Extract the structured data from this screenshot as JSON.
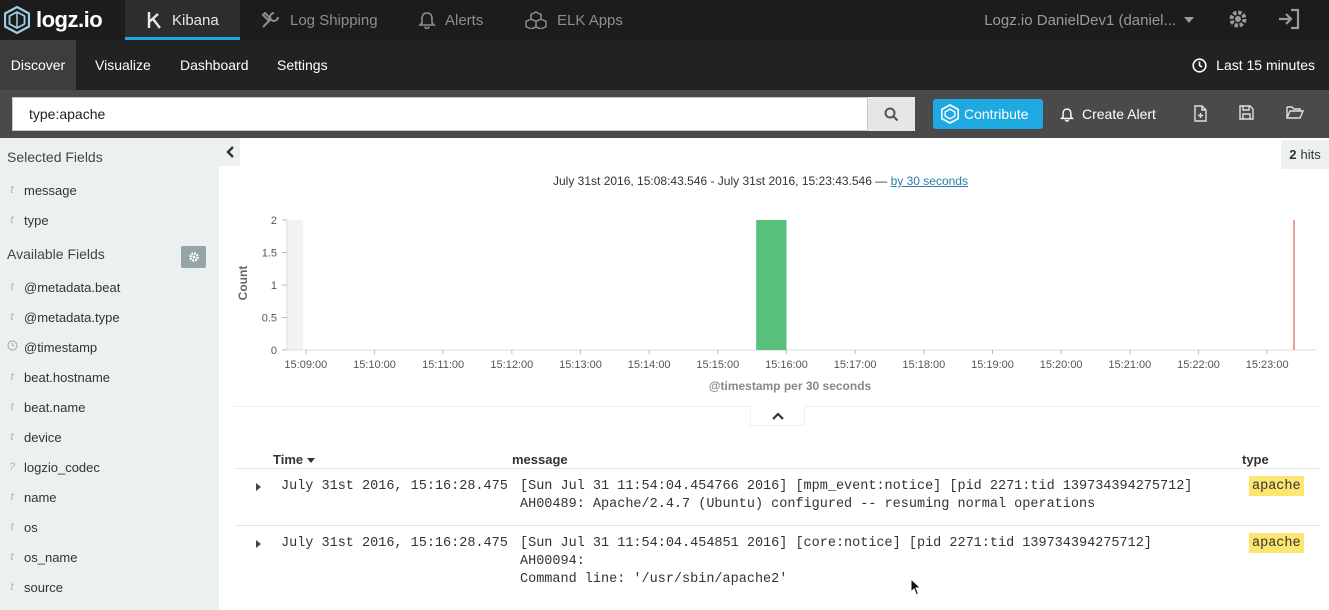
{
  "app": {
    "brand": "logz.io"
  },
  "topnav": {
    "items": [
      {
        "label": "Kibana",
        "icon": "kibana-icon"
      },
      {
        "label": "Log Shipping",
        "icon": "tools-icon"
      },
      {
        "label": "Alerts",
        "icon": "bell-icon"
      },
      {
        "label": "ELK Apps",
        "icon": "boxes-icon"
      }
    ],
    "account": "Logz.io DanielDev1 (daniel...",
    "icons": [
      "gear-icon",
      "sign-out-icon"
    ]
  },
  "subnav": {
    "items": [
      "Discover",
      "Visualize",
      "Dashboard",
      "Settings"
    ],
    "time_range": "Last 15 minutes"
  },
  "search": {
    "query": "type:apache",
    "contribute_label": "Contribute",
    "create_alert_label": "Create Alert"
  },
  "sidebar": {
    "selected_title": "Selected Fields",
    "available_title": "Available Fields",
    "selected_fields": [
      {
        "type": "t",
        "name": "message"
      },
      {
        "type": "t",
        "name": "type"
      }
    ],
    "available_fields": [
      {
        "type": "t",
        "name": "@metadata.beat"
      },
      {
        "type": "t",
        "name": "@metadata.type"
      },
      {
        "type": "clock",
        "name": "@timestamp"
      },
      {
        "type": "t",
        "name": "beat.hostname"
      },
      {
        "type": "t",
        "name": "beat.name"
      },
      {
        "type": "t",
        "name": "device"
      },
      {
        "type": "?",
        "name": "logzio_codec"
      },
      {
        "type": "t",
        "name": "name"
      },
      {
        "type": "t",
        "name": "os"
      },
      {
        "type": "t",
        "name": "os_name"
      },
      {
        "type": "t",
        "name": "source"
      }
    ]
  },
  "hits": {
    "count": "2",
    "label": "hits"
  },
  "range": {
    "text": "July 31st 2016, 15:08:43.546 - July 31st 2016, 15:23:43.546 —",
    "interval_link": "by 30 seconds"
  },
  "chart_data": {
    "type": "bar",
    "x": [
      "15:09:00",
      "15:10:00",
      "15:11:00",
      "15:12:00",
      "15:13:00",
      "15:14:00",
      "15:15:00",
      "15:16:00",
      "15:17:00",
      "15:18:00",
      "15:19:00",
      "15:20:00",
      "15:21:00",
      "15:22:00",
      "15:23:00"
    ],
    "bars": [
      {
        "x": "15:16:00",
        "value": 2
      }
    ],
    "xlabel": "@timestamp per 30 seconds",
    "ylabel": "Count",
    "yticks": [
      "0",
      "0.5",
      "1",
      "1.5",
      "2"
    ],
    "ylim": [
      0,
      2
    ],
    "bar_color": "#57c17b",
    "now_marker_color": "#e8a0a0"
  },
  "table": {
    "headers": {
      "time": "Time",
      "message": "message",
      "type": "type"
    },
    "rows": [
      {
        "time": "July 31st 2016, 15:16:28.475",
        "message_line1": "[Sun Jul 31 11:54:04.454766 2016] [mpm_event:notice] [pid 2271:tid 139734394275712]",
        "message_line2": "AH00489: Apache/2.4.7 (Ubuntu) configured -- resuming normal operations",
        "type": "apache"
      },
      {
        "time": "July 31st 2016, 15:16:28.475",
        "message_line1": "[Sun Jul 31 11:54:04.454851 2016] [core:notice] [pid 2271:tid 139734394275712] AH00094:",
        "message_line2": "Command line: '/usr/sbin/apache2'",
        "type": "apache"
      }
    ]
  },
  "colors": {
    "accent": "#1ea9e2",
    "badge": "#fce571",
    "sidebar": "#ecf0f1"
  }
}
